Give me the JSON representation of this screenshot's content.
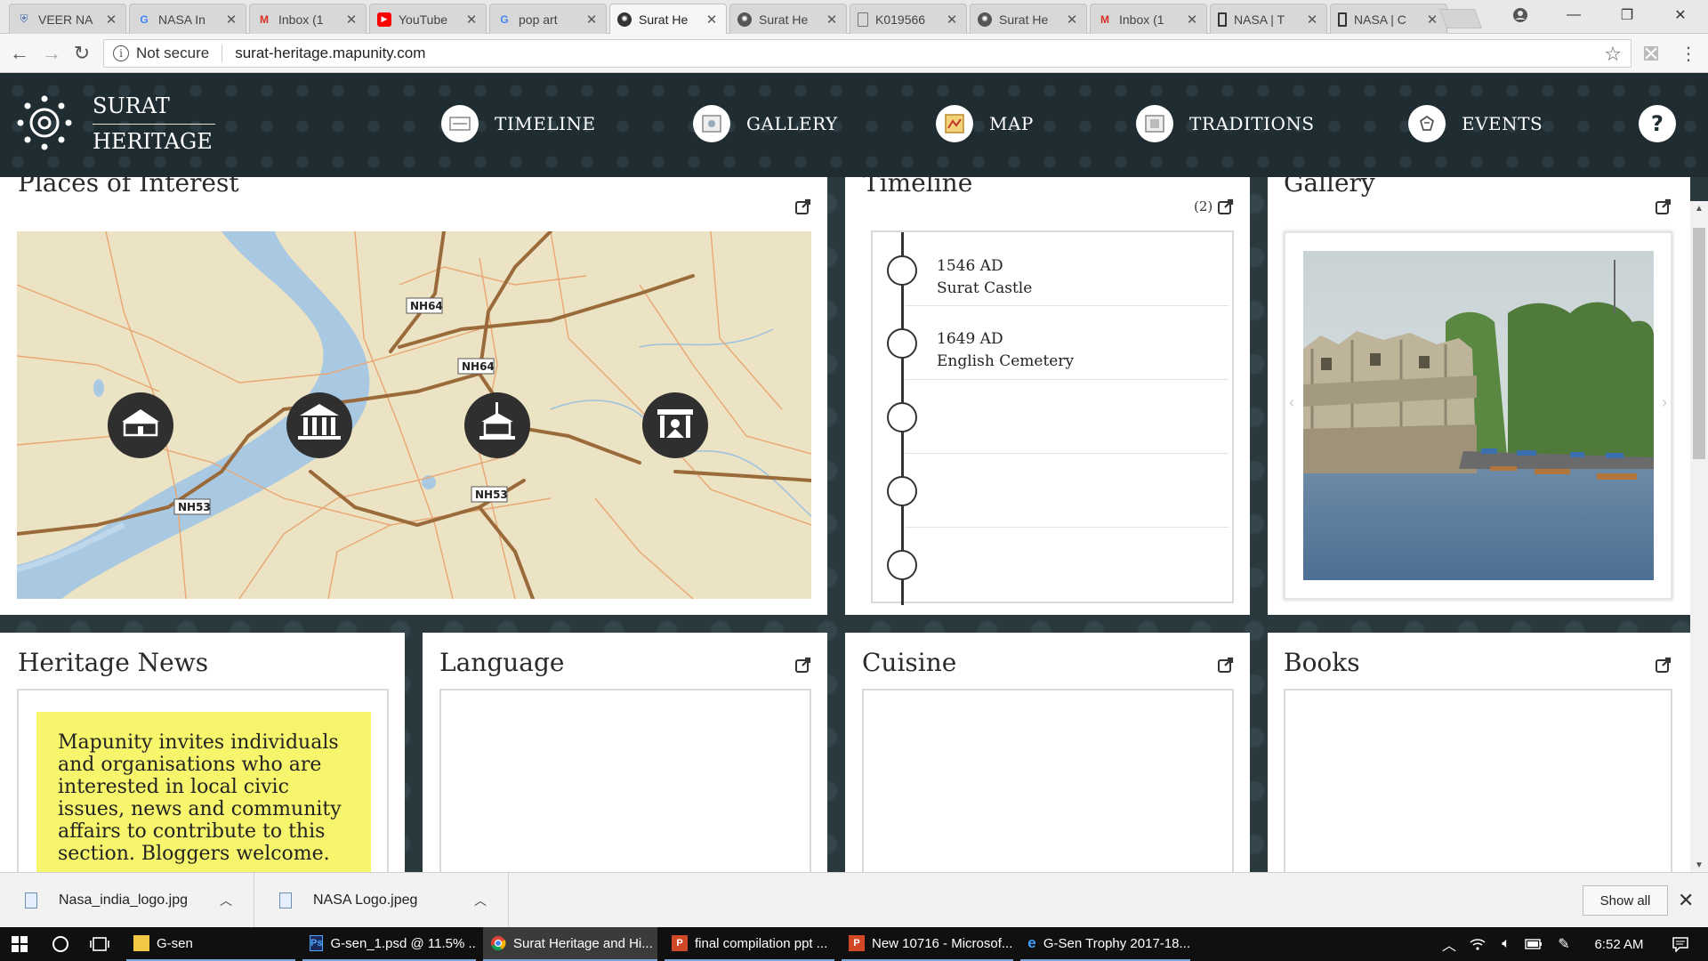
{
  "browser": {
    "tabs": [
      {
        "title": "VEER NA",
        "icon": "shield-icon",
        "color": "#3a66b5"
      },
      {
        "title": "NASA In",
        "icon": "google-icon",
        "color": "#4285f4"
      },
      {
        "title": "Inbox (1",
        "icon": "gmail-icon",
        "color": "#d93025"
      },
      {
        "title": "YouTube",
        "icon": "youtube-icon",
        "color": "#ff0000"
      },
      {
        "title": "pop art",
        "icon": "google-icon",
        "color": "#4285f4"
      },
      {
        "title": "Surat He",
        "icon": "heritage-icon",
        "color": "#333333",
        "active": true
      },
      {
        "title": "Surat He",
        "icon": "heritage-icon",
        "color": "#555555"
      },
      {
        "title": "K019566",
        "icon": "document-icon",
        "color": "#777777"
      },
      {
        "title": "Surat He",
        "icon": "heritage-icon",
        "color": "#555555"
      },
      {
        "title": "Inbox (1",
        "icon": "gmail-icon",
        "color": "#d93025"
      },
      {
        "title": "NASA | T",
        "icon": "bookmark-icon",
        "color": "#333333"
      },
      {
        "title": "NASA | C",
        "icon": "bookmark-icon",
        "color": "#333333"
      }
    ],
    "security_label": "Not secure",
    "url": "surat-heritage.mapunity.com"
  },
  "site": {
    "brand_line1": "SURAT",
    "brand_line2": "HERITAGE",
    "nav": [
      {
        "label": "TIMELINE",
        "icon": "timeline-icon"
      },
      {
        "label": "GALLERY",
        "icon": "gallery-icon"
      },
      {
        "label": "MAP",
        "icon": "map-icon"
      },
      {
        "label": "TRADITIONS",
        "icon": "traditions-icon"
      },
      {
        "label": "EVENTS",
        "icon": "events-icon"
      }
    ],
    "help_label": "?"
  },
  "panels": {
    "places": {
      "title": "Places of Interest",
      "road_labels": [
        "NH64",
        "NH64",
        "NH53",
        "NH53"
      ],
      "markers": [
        "school-marker-icon",
        "museum-marker-icon",
        "monument-marker-icon",
        "temple-marker-icon"
      ]
    },
    "timeline": {
      "title": "Timeline",
      "count": "(2)",
      "entries": [
        {
          "year": "1546 AD",
          "name": "Surat Castle"
        },
        {
          "year": "1649 AD",
          "name": "English Cemetery"
        },
        {
          "year": "",
          "name": ""
        },
        {
          "year": "",
          "name": ""
        },
        {
          "year": "",
          "name": ""
        }
      ]
    },
    "gallery": {
      "title": "Gallery"
    },
    "news": {
      "title": "Heritage News",
      "note": "Mapunity invites individuals and organisations who are interested in local civic issues, news and community affairs to contribute to this section. Bloggers welcome."
    },
    "language": {
      "title": "Language"
    },
    "cuisine": {
      "title": "Cuisine"
    },
    "books": {
      "title": "Books"
    }
  },
  "downloads": {
    "items": [
      {
        "name": "Nasa_india_logo.jpg"
      },
      {
        "name": "NASA Logo.jpeg"
      }
    ],
    "show_all": "Show all"
  },
  "taskbar": {
    "apps": [
      {
        "label": "G-sen",
        "icon": "folder-icon",
        "color": "#f2c744"
      },
      {
        "label": "G-sen_1.psd @ 11.5% ...",
        "icon": "photoshop-icon",
        "color": "#2c6bd6"
      },
      {
        "label": "Surat Heritage and Hi...",
        "icon": "chrome-icon",
        "color": "#4caf50",
        "active": true
      },
      {
        "label": "final compilation ppt ...",
        "icon": "powerpoint-icon",
        "color": "#d24726"
      },
      {
        "label": "New 10716 - Microsof...",
        "icon": "powerpoint-icon",
        "color": "#d24726"
      },
      {
        "label": "G-Sen Trophy 2017-18...",
        "icon": "edge-icon",
        "color": "#1e88e5"
      }
    ],
    "time": "6:52 AM"
  }
}
